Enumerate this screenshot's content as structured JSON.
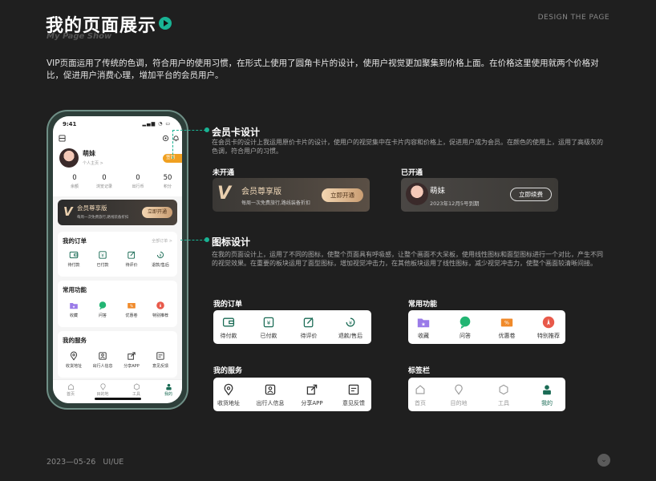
{
  "header": {
    "title": "我的页面展示",
    "subtitle": "My Page Show",
    "design_label": "DESIGN THE PAGE"
  },
  "intro": "VIP页面运用了传统的色调，符合用户的使用习惯，在形式上使用了圆角卡片的设计，使用户视觉更加聚集到价格上面。在价格这里使用就两个价格对比，促进用户消费心理，增加平台的会员用户。",
  "footer": {
    "date": "2023—05-26",
    "tag": "UI/UE"
  },
  "phone": {
    "time": "9:41",
    "user_name": "萌妹",
    "user_home": "个人主页 >",
    "sign_label": "签到",
    "stats": [
      {
        "value": "0",
        "label": "余额"
      },
      {
        "value": "0",
        "label": "浏览记录"
      },
      {
        "value": "0",
        "label": "出行币"
      },
      {
        "value": "50",
        "label": "积分"
      }
    ],
    "vip": {
      "title": "会员尊享版",
      "desc": "每周一次免费旅行,路线装备折扣",
      "button": "立即开通"
    },
    "orders": {
      "title": "我的订单",
      "more": "全部订单 >",
      "items": [
        "待付款",
        "已付款",
        "待评价",
        "退款/售后"
      ]
    },
    "functions": {
      "title": "常用功能",
      "items": [
        "收藏",
        "问答",
        "优惠卷",
        "特别推荐"
      ]
    },
    "services": {
      "title": "我的服务",
      "items": [
        "收货地址",
        "出行人信息",
        "分享APP",
        "意见反馈"
      ]
    },
    "tabs": [
      "首页",
      "目的地",
      "工具",
      "我的"
    ]
  },
  "member_section": {
    "title": "会员卡设计",
    "desc": "在会员卡的设计上我运用原价卡片的设计，使用户的视觉集中在卡片内容和价格上，促进用户成为会员。在颜色的使用上，运用了高级灰的色调，符合用户的习惯。",
    "unopened_label": "未开通",
    "opened_label": "已开通",
    "unopened_card": {
      "title": "会员尊享版",
      "desc": "每周一次免费旅行,路线装备折扣",
      "button": "立即开通"
    },
    "opened_card": {
      "name": "萌妹",
      "date": "2023年12月5号到期",
      "button": "立即续费"
    }
  },
  "icon_section": {
    "title": "图标设计",
    "desc": "在我的页面设计上，运用了不同的图标，使整个页面具有呼吸感，让整个画面不大呆板，使用线性图标和面型图标进行一个对比，产生不同的视觉效果。在重要的板块运用了面型图标，增加视觉冲击力，在其他板块运用了线性图标，减少视觉冲击力，使整个画面较清晰间接。",
    "orders": {
      "title": "我的订单",
      "items": [
        "待付款",
        "已付款",
        "待评价",
        "退款/售后"
      ]
    },
    "functions": {
      "title": "常用功能",
      "items": [
        "收藏",
        "问答",
        "优惠卷",
        "特别推荐"
      ]
    },
    "services": {
      "title": "我的服务",
      "items": [
        "收货地址",
        "出行人信息",
        "分享APP",
        "意见反馈"
      ]
    },
    "tabbar": {
      "title": "标签栏",
      "items": [
        "首页",
        "目的地",
        "工具",
        "我的"
      ]
    }
  },
  "colors": {
    "accent": "#19b394",
    "bg": "#1f1f1f",
    "gold": "#f1d9b9"
  }
}
